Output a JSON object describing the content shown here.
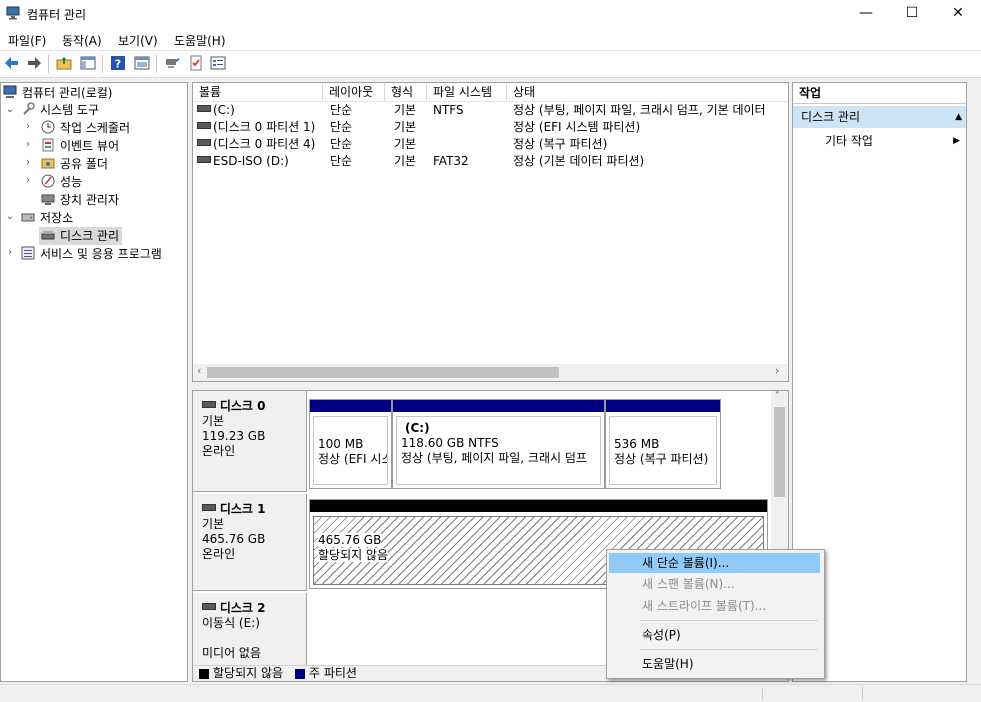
{
  "window": {
    "title": "컴퓨터 관리",
    "minimize": "—",
    "maximize": "☐",
    "close": "✕"
  },
  "menubar": [
    "파일(F)",
    "동작(A)",
    "보기(V)",
    "도움말(H)"
  ],
  "tree": {
    "items": [
      {
        "label": "컴퓨터 관리(로컬)",
        "icon": "computer-icon"
      },
      {
        "label": "시스템 도구",
        "icon": "tools-icon"
      },
      {
        "label": "작업 스케줄러",
        "icon": "clock-icon"
      },
      {
        "label": "이벤트 뷰어",
        "icon": "event-viewer-icon"
      },
      {
        "label": "공유 폴더",
        "icon": "shared-folder-icon"
      },
      {
        "label": "성능",
        "icon": "performance-icon"
      },
      {
        "label": "장치 관리자",
        "icon": "device-manager-icon"
      },
      {
        "label": "저장소",
        "icon": "storage-icon"
      },
      {
        "label": "디스크 관리",
        "icon": "disk-icon"
      },
      {
        "label": "서비스 및 응용 프로그램",
        "icon": "services-icon"
      }
    ]
  },
  "volume_list": {
    "columns": [
      "볼륨",
      "레이아웃",
      "형식",
      "파일 시스템",
      "상태"
    ],
    "rows": [
      {
        "volume": "(C:)",
        "layout": "단순",
        "type": "기본",
        "fs": "NTFS",
        "status": "정상 (부팅, 페이지 파일, 크래시 덤프, 기본 데이터"
      },
      {
        "volume": "(디스크 0 파티션 1)",
        "layout": "단순",
        "type": "기본",
        "fs": "",
        "status": "정상 (EFI 시스템 파티션)"
      },
      {
        "volume": "(디스크 0 파티션 4)",
        "layout": "단순",
        "type": "기본",
        "fs": "",
        "status": "정상 (복구 파티션)"
      },
      {
        "volume": "ESD-ISO (D:)",
        "layout": "단순",
        "type": "기본",
        "fs": "FAT32",
        "status": "정상 (기본 데이터 파티션)"
      }
    ]
  },
  "disks": [
    {
      "name": "디스크 0",
      "kind": "기본",
      "size": "119.23 GB",
      "state": "온라인",
      "partitions": [
        {
          "title": "",
          "size": "100 MB",
          "status": "정상 (EFI 시스"
        },
        {
          "title": "(C:)",
          "size": "118.60 GB NTFS",
          "status": "정상 (부팅, 페이지 파일, 크래시 덤프"
        },
        {
          "title": "",
          "size": "536 MB",
          "status": "정상 (복구 파티션)"
        }
      ]
    },
    {
      "name": "디스크 1",
      "kind": "기본",
      "size": "465.76 GB",
      "state": "온라인",
      "partitions": [
        {
          "title": "",
          "size": "465.76 GB",
          "status": "할당되지 않음"
        }
      ]
    },
    {
      "name": "디스크 2",
      "kind": "이동식 (E:)",
      "size": "",
      "state": "미디어 없음",
      "partitions": []
    }
  ],
  "legend": [
    {
      "label": "할당되지 않음",
      "color": "#000000"
    },
    {
      "label": "주 파티션",
      "color": "#000080"
    }
  ],
  "actions": {
    "header": "작업",
    "section": "디스크 관리",
    "item": "기타 작업"
  },
  "context_menu": [
    {
      "label": "새 단순 볼륨(I)...",
      "state": "highlighted"
    },
    {
      "label": "새 스팬 볼륨(N)...",
      "state": "disabled"
    },
    {
      "label": "새 스트라이프 볼륨(T)...",
      "state": "disabled"
    },
    {
      "label": "속성(P)",
      "state": "enabled"
    },
    {
      "label": "도움말(H)",
      "state": "enabled"
    }
  ],
  "colors": {
    "primary_partition": "#000080",
    "unallocated": "#000000",
    "selection": "#91c9f7",
    "actions_header": "#cde4f7"
  }
}
